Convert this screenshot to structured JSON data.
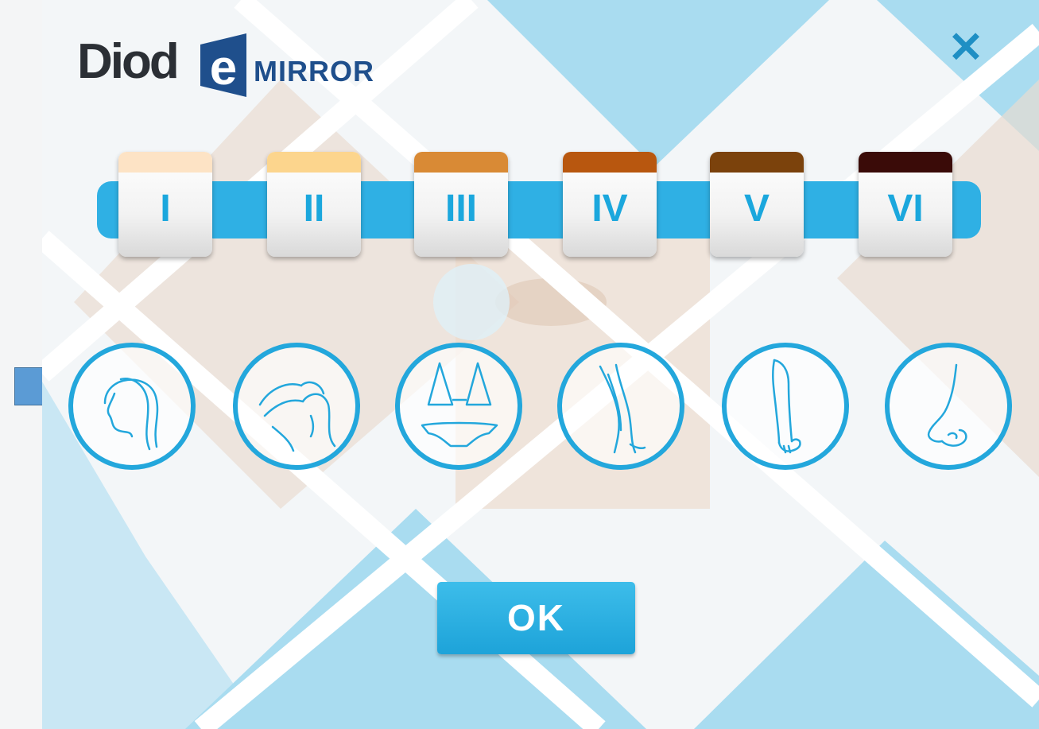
{
  "header": {
    "logo_main": "Diod",
    "logo_e": "e",
    "logo_sub": "MIRROR",
    "close_glyph": "✕"
  },
  "skin_types": [
    {
      "label": "I",
      "swatch": "#fde3c5"
    },
    {
      "label": "II",
      "swatch": "#fcd58d"
    },
    {
      "label": "III",
      "swatch": "#d98a35"
    },
    {
      "label": "IV",
      "swatch": "#b8570f"
    },
    {
      "label": "V",
      "swatch": "#7b420c"
    },
    {
      "label": "VI",
      "swatch": "#3a0b08"
    }
  ],
  "body_zones": [
    {
      "icon": "face-icon"
    },
    {
      "icon": "armpit-icon"
    },
    {
      "icon": "bikini-icon"
    },
    {
      "icon": "legs-icon"
    },
    {
      "icon": "arm-icon"
    },
    {
      "icon": "nose-icon"
    }
  ],
  "ok_label": "OK",
  "colors": {
    "accent": "#23a7dc",
    "brand_dark": "#1f4f8c",
    "bg_tint": "#a9dcf0"
  }
}
